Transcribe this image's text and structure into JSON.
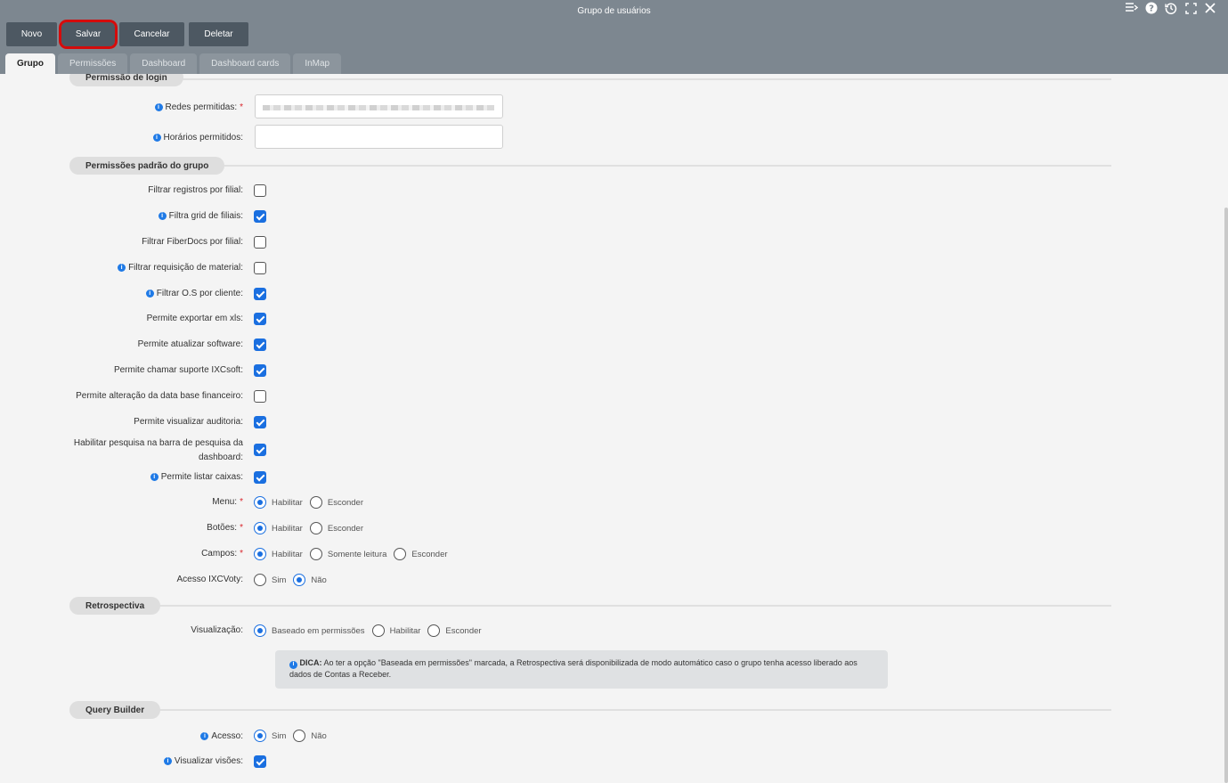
{
  "window": {
    "title": "Grupo de usuários",
    "icons": [
      "list-menu-icon",
      "help-icon",
      "history-icon",
      "fullscreen-icon",
      "close-icon"
    ]
  },
  "toolbar": {
    "new_label": "Novo",
    "save_label": "Salvar",
    "cancel_label": "Cancelar",
    "delete_label": "Deletar"
  },
  "tabs": [
    {
      "label": "Grupo",
      "active": true
    },
    {
      "label": "Permissões"
    },
    {
      "label": "Dashboard"
    },
    {
      "label": "Dashboard cards"
    },
    {
      "label": "InMap"
    }
  ],
  "login_section": {
    "title": "Permissão de login",
    "allowed_networks_label": "Redes permitidas:",
    "allowed_hours_label": "Horários permitidos:",
    "allowed_hours_value": ""
  },
  "defaults_section": {
    "title": "Permissões padrão do grupo",
    "checkboxes": [
      {
        "label": "Filtrar registros por filial:",
        "checked": false,
        "info": false
      },
      {
        "label": "Filtra grid de filiais:",
        "checked": true,
        "info": true
      },
      {
        "label": "Filtrar FiberDocs por filial:",
        "checked": false,
        "info": false
      },
      {
        "label": "Filtrar requisição de material:",
        "checked": false,
        "info": true
      },
      {
        "label": "Filtrar O.S por cliente:",
        "checked": true,
        "info": true
      },
      {
        "label": "Permite exportar em xls:",
        "checked": true,
        "info": false
      },
      {
        "label": "Permite atualizar software:",
        "checked": true,
        "info": false
      },
      {
        "label": "Permite chamar suporte IXCsoft:",
        "checked": true,
        "info": false
      },
      {
        "label": "Permite alteração da data base financeiro:",
        "checked": false,
        "info": false
      },
      {
        "label": "Permite visualizar auditoria:",
        "checked": true,
        "info": false
      },
      {
        "label_line1": "Habilitar pesquisa na barra de pesquisa da",
        "label_line2": "dashboard:",
        "checked": true,
        "info": false
      },
      {
        "label": "Permite listar caixas:",
        "checked": true,
        "info": true
      }
    ],
    "menu": {
      "label": "Menu:",
      "options": [
        "Habilitar",
        "Esconder"
      ],
      "selected": "Habilitar"
    },
    "buttons": {
      "label": "Botões:",
      "options": [
        "Habilitar",
        "Esconder"
      ],
      "selected": "Habilitar"
    },
    "fields": {
      "label": "Campos:",
      "options": [
        "Habilitar",
        "Somente leitura",
        "Esconder"
      ],
      "selected": "Habilitar"
    },
    "ixcvoty": {
      "label": "Acesso IXCVoty:",
      "options": [
        "Sim",
        "Não"
      ],
      "selected": "Não"
    }
  },
  "retro_section": {
    "title": "Retrospectiva",
    "view": {
      "label": "Visualização:",
      "options": [
        "Baseado em permissões",
        "Habilitar",
        "Esconder"
      ],
      "selected": "Baseado em permissões"
    },
    "tip_bold": "DICA:",
    "tip_text": " Ao ter a opção \"Baseada em permissões\" marcada, a Retrospectiva será disponibilizada de modo automático caso o grupo tenha acesso liberado aos dados de Contas a Receber."
  },
  "query_section": {
    "title": "Query Builder",
    "access": {
      "label": "Acesso:",
      "options": [
        "Sim",
        "Não"
      ],
      "selected": "Sim"
    },
    "views_label": "Visualizar visões:",
    "views_checked": true
  },
  "info_glyph": "i",
  "required_mark": "*"
}
